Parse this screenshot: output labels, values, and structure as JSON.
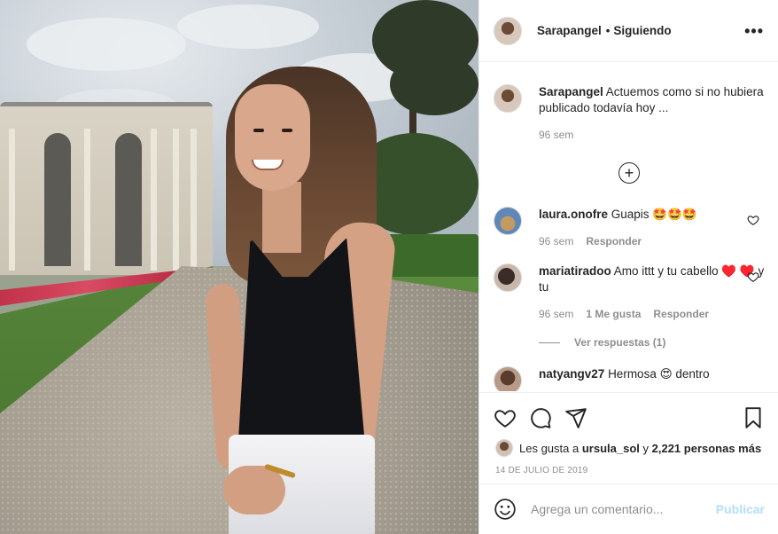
{
  "post": {
    "author": "Sarapangel",
    "follow_status": "Siguiendo",
    "separator": "•",
    "more_options": "•••"
  },
  "caption": {
    "user": "Sarapangel",
    "text": "Actuemos como si no hubiera publicado todavía hoy ...",
    "time": "96 sem"
  },
  "load_more_icon": "plus-circle-icon",
  "comments": [
    {
      "user": "laura.onofre",
      "text": "Guapis 🤩🤩🤩",
      "time": "96 sem",
      "likes": "",
      "reply": "Responder"
    },
    {
      "user": "mariatiradoo",
      "text": "Amo ittt y tu cabello ♥️ ♥️ y tu",
      "time": "96 sem",
      "likes": "1 Me gusta",
      "reply": "Responder"
    },
    {
      "user": "natyangv27",
      "text": "Hermosa 😍 dentro",
      "time": "",
      "likes": "",
      "reply": ""
    }
  ],
  "view_replies": "Ver respuestas (1)",
  "likes": {
    "prefix": "Les gusta a",
    "user": "ursula_sol",
    "connector": "y",
    "count": "2,221 personas más"
  },
  "date": "14 DE JULIO DE 2019",
  "add_comment": {
    "placeholder": "Agrega un comentario...",
    "publish": "Publicar"
  },
  "icons": [
    "heart-icon",
    "comment-icon",
    "share-icon",
    "bookmark-icon",
    "emoji-icon",
    "more-icon"
  ],
  "colors": {
    "link_disabled": "#b2dffc",
    "secondary_text": "#8e8e8e",
    "primary_text": "#262626",
    "border": "#efefef"
  }
}
